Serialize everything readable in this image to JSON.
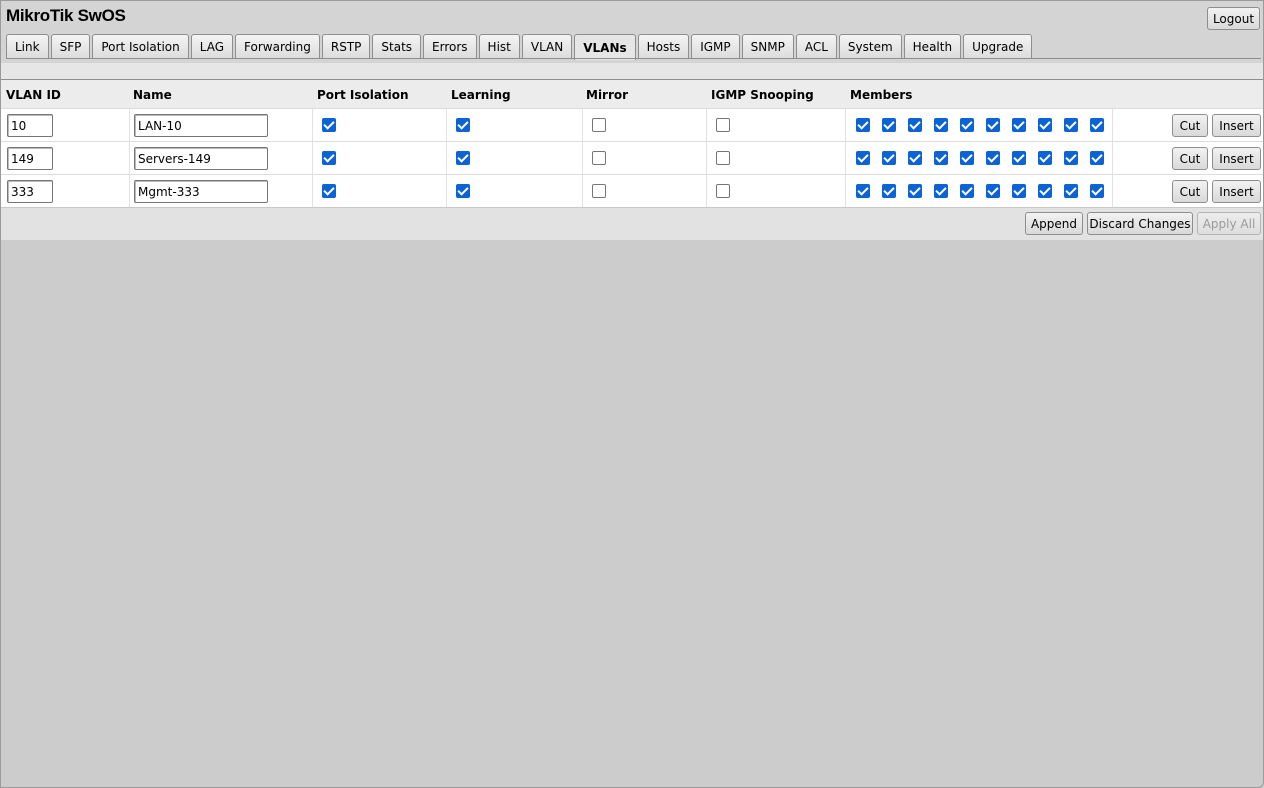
{
  "app": {
    "title": "MikroTik SwOS",
    "logout_label": "Logout"
  },
  "tabs": [
    {
      "label": "Link",
      "active": false
    },
    {
      "label": "SFP",
      "active": false
    },
    {
      "label": "Port Isolation",
      "active": false
    },
    {
      "label": "LAG",
      "active": false
    },
    {
      "label": "Forwarding",
      "active": false
    },
    {
      "label": "RSTP",
      "active": false
    },
    {
      "label": "Stats",
      "active": false
    },
    {
      "label": "Errors",
      "active": false
    },
    {
      "label": "Hist",
      "active": false
    },
    {
      "label": "VLAN",
      "active": false
    },
    {
      "label": "VLANs",
      "active": true
    },
    {
      "label": "Hosts",
      "active": false
    },
    {
      "label": "IGMP",
      "active": false
    },
    {
      "label": "SNMP",
      "active": false
    },
    {
      "label": "ACL",
      "active": false
    },
    {
      "label": "System",
      "active": false
    },
    {
      "label": "Health",
      "active": false
    },
    {
      "label": "Upgrade",
      "active": false
    }
  ],
  "table": {
    "headers": {
      "vlan_id": "VLAN ID",
      "name": "Name",
      "port_isolation": "Port Isolation",
      "learning": "Learning",
      "mirror": "Mirror",
      "igmp_snooping": "IGMP Snooping",
      "members": "Members"
    },
    "cut_label": "Cut",
    "insert_label": "Insert",
    "rows": [
      {
        "vlan_id": "10",
        "name": "LAN-10",
        "port_isolation": true,
        "learning": true,
        "mirror": false,
        "igmp_snooping": false,
        "members": [
          true,
          true,
          true,
          true,
          true,
          true,
          true,
          true,
          true,
          true
        ]
      },
      {
        "vlan_id": "149",
        "name": "Servers-149",
        "port_isolation": true,
        "learning": true,
        "mirror": false,
        "igmp_snooping": false,
        "members": [
          true,
          true,
          true,
          true,
          true,
          true,
          true,
          true,
          true,
          true
        ]
      },
      {
        "vlan_id": "333",
        "name": "Mgmt-333",
        "port_isolation": true,
        "learning": true,
        "mirror": false,
        "igmp_snooping": false,
        "members": [
          true,
          true,
          true,
          true,
          true,
          true,
          true,
          true,
          true,
          true
        ]
      }
    ]
  },
  "footer": {
    "append_label": "Append",
    "discard_label": "Discard Changes",
    "apply_label": "Apply All",
    "apply_enabled": false
  },
  "colors": {
    "checkbox_checked": "#0b63d6",
    "background": "#cccccc"
  }
}
